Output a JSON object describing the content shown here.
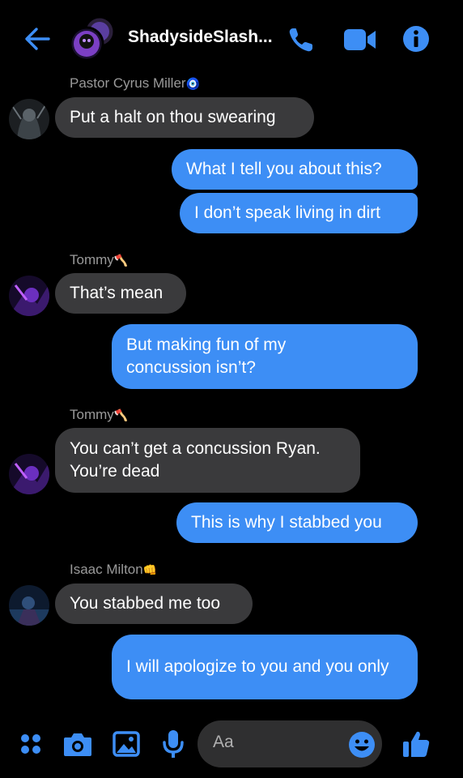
{
  "header": {
    "title": "ShadysideSlash...",
    "back_icon": "arrow-left-icon",
    "call_icon": "phone-icon",
    "video_icon": "video-camera-icon",
    "info_icon": "info-icon",
    "accent": "#3d8ef5"
  },
  "messages": [
    {
      "sender": "Pastor Cyrus Miller",
      "sender_emoji": "🧿",
      "direction": "incoming",
      "text": "Put a halt on thou swearing"
    },
    {
      "direction": "outgoing",
      "text": "What I tell you about this?"
    },
    {
      "direction": "outgoing",
      "text": "I don’t speak living in dirt"
    },
    {
      "sender": "Tommy",
      "sender_emoji": "🪓",
      "direction": "incoming",
      "text": "That’s mean"
    },
    {
      "direction": "outgoing",
      "text": "But making fun of my concussion isn’t?"
    },
    {
      "sender": "Tommy",
      "sender_emoji": "🪓",
      "direction": "incoming",
      "text": "You can’t get a concussion Ryan. You’re dead"
    },
    {
      "direction": "outgoing",
      "text": "This is why I stabbed you"
    },
    {
      "sender": "Isaac Milton",
      "sender_emoji": "👊",
      "direction": "incoming",
      "text": "You stabbed me too"
    },
    {
      "direction": "outgoing",
      "text": "I will apologize to you and you only"
    }
  ],
  "composer": {
    "placeholder": "Aa",
    "icons": [
      "apps-icon",
      "camera-icon",
      "image-icon",
      "microphone-icon",
      "emoji-icon",
      "thumbs-up-icon"
    ]
  },
  "colors": {
    "incoming_bubble": "#3a3a3c",
    "outgoing_bubble": "#3d8ef5",
    "background": "#000000"
  }
}
